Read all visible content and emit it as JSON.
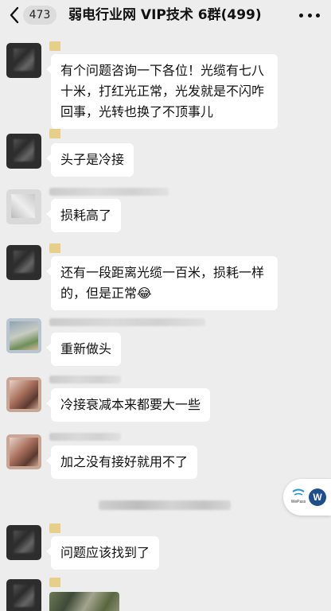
{
  "header": {
    "unread_count": "473",
    "title": "弱电行业网 VIP技术 6群(499)"
  },
  "messages": [
    {
      "text": "有个问题咨询一下各位！光缆有七八十米，打红光正常，光发就是不闪咋回事，光转也换了不顶事儿"
    },
    {
      "text": "头子是冷接"
    },
    {
      "text": "损耗高了"
    },
    {
      "text": "还有一段距离光缆一百米，损耗一样的，但是正常"
    },
    {
      "text": "重新做头"
    },
    {
      "text": "冷接衰减本来都要大一些"
    },
    {
      "text": "加之没有接好就用不了"
    },
    {
      "text": "问题应该找到了"
    }
  ],
  "emoji": "😂",
  "widget": {
    "badge": "W",
    "logo_text": "WePass"
  },
  "colors": {
    "background": "#ededed",
    "bubble": "#ffffff",
    "badge": "#1f4e8c"
  }
}
